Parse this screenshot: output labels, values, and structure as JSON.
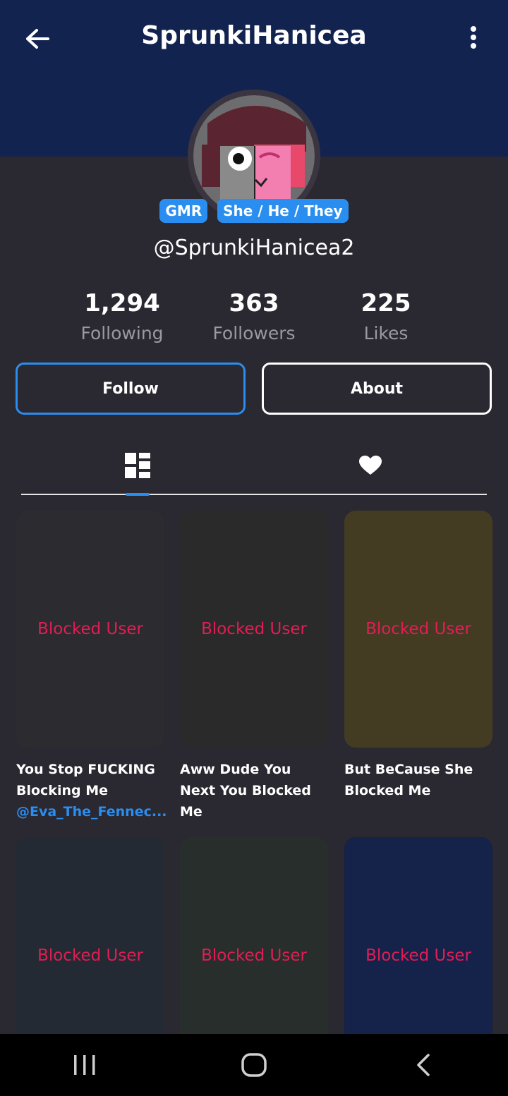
{
  "header": {
    "title": "SprunkiHanicea",
    "back_icon": "arrow-left-icon",
    "more_icon": "more-vertical-icon",
    "band_color": "#13234f"
  },
  "profile": {
    "badges": [
      "GMR",
      "She / He / They"
    ],
    "handle": "@SprunkiHanicea2",
    "stats": [
      {
        "value": "1,294",
        "label": "Following"
      },
      {
        "value": "363",
        "label": "Followers"
      },
      {
        "value": "225",
        "label": "Likes"
      }
    ]
  },
  "actions": {
    "follow_label": "Follow",
    "about_label": "About"
  },
  "tabs": [
    {
      "icon": "grid-layout-icon",
      "active": true
    },
    {
      "icon": "heart-icon",
      "active": false
    }
  ],
  "posts": [
    {
      "label": "Blocked User",
      "bg": "#2c2b2f",
      "caption": "You Stop FUCKING Blocking Me",
      "mention": "@Eva_The_Fennec..."
    },
    {
      "label": "Blocked User",
      "bg": "#2a2a2a",
      "caption": "Aww Dude You Next You Blocked Me",
      "mention": ""
    },
    {
      "label": "Blocked User",
      "bg": "#433b22",
      "caption": "But BeCause She Blocked Me",
      "mention": ""
    },
    {
      "label": "Blocked User",
      "bg": "#232a33",
      "caption": "",
      "mention": ""
    },
    {
      "label": "Blocked User",
      "bg": "#282e2b",
      "caption": "",
      "mention": ""
    },
    {
      "label": "Blocked User",
      "bg": "#15224a",
      "caption": "",
      "mention": ""
    }
  ],
  "colors": {
    "accent": "#2a8ef0",
    "blocked_text": "#e01e55",
    "background": "#2a2830"
  },
  "system_nav": {
    "recents_icon": "recents-icon",
    "home_icon": "home-icon",
    "back_icon": "back-chevron-icon"
  }
}
